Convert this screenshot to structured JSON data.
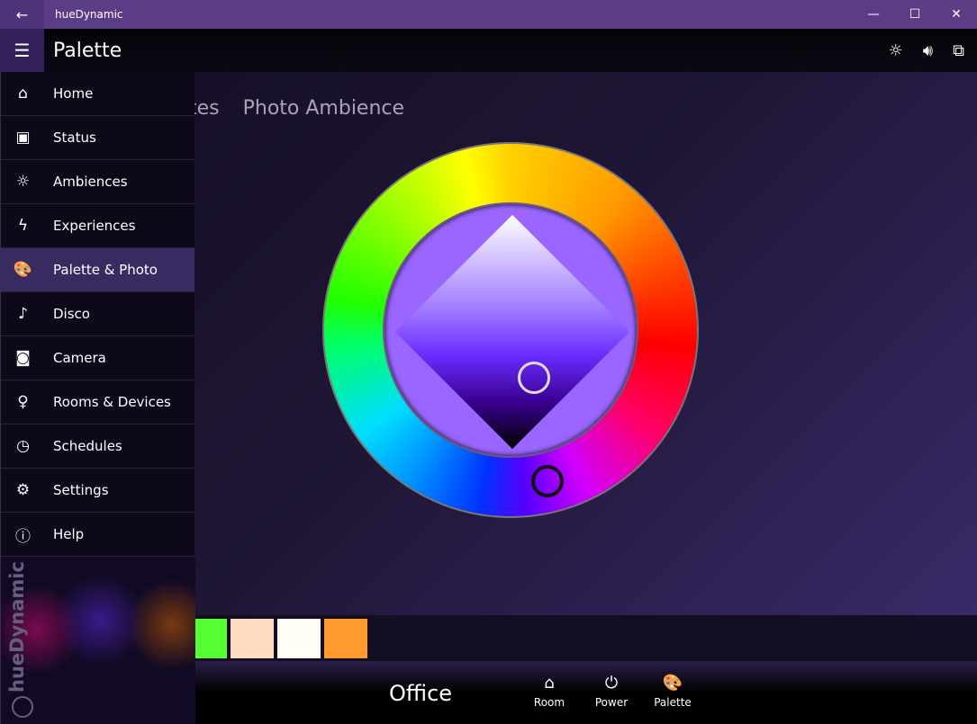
{
  "window": {
    "title": "hueDynamic",
    "back_icon": "arrow-left-icon"
  },
  "header": {
    "title": "Palette",
    "icons": [
      "brightness-icon",
      "volume-icon",
      "cast-icon"
    ]
  },
  "tabs": [
    "tes",
    "Photo Ambience"
  ],
  "sidebar": {
    "items": [
      {
        "label": "Home",
        "icon": "⌂"
      },
      {
        "label": "Status",
        "icon": "▣"
      },
      {
        "label": "Ambiences",
        "icon": "☼"
      },
      {
        "label": "Experiences",
        "icon": "ϟ"
      },
      {
        "label": "Palette & Photo",
        "icon": "🎨",
        "selected": true
      },
      {
        "label": "Disco",
        "icon": "♪"
      },
      {
        "label": "Camera",
        "icon": "◙"
      },
      {
        "label": "Rooms & Devices",
        "icon": "♀"
      },
      {
        "label": "Schedules",
        "icon": "◷"
      },
      {
        "label": "Settings",
        "icon": "⚙"
      },
      {
        "label": "Help",
        "icon": "ⓘ"
      }
    ],
    "brand": "hueDynamic"
  },
  "palette": {
    "swatches": [
      "#55ff33",
      "#ffdcc0",
      "#fffdf6",
      "#ff9a2e"
    ]
  },
  "bottom": {
    "room": "Office",
    "buttons": [
      {
        "label": "Room",
        "icon": "⌂"
      },
      {
        "label": "Power",
        "icon": "⏻"
      },
      {
        "label": "Palette",
        "icon": "🎨"
      }
    ]
  },
  "colors": {
    "titlebar": "#5b3d86",
    "selected": "#3a2a62",
    "inner_circle": "#9a66ff"
  }
}
